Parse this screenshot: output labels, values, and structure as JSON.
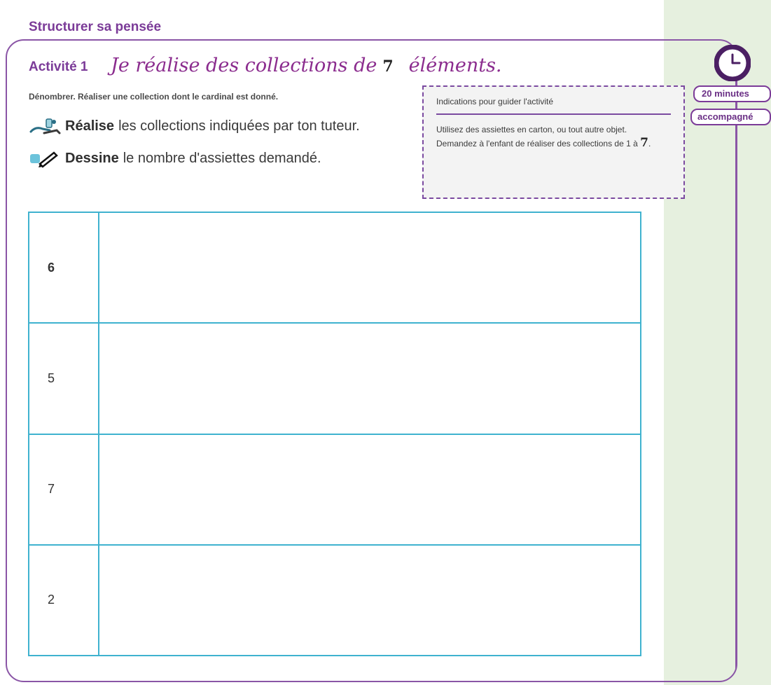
{
  "header": {
    "section_title": "Structurer sa pensée"
  },
  "activity": {
    "label": "Activité 1",
    "title_part1": "Je réalise des collections de",
    "title_number": "7",
    "title_part2": "éléments.",
    "objective": "Dénombrer. Réaliser une collection dont le cardinal est donné."
  },
  "time_badges": {
    "duration": "20 minutes",
    "mode": "accompagné"
  },
  "instructions": [
    {
      "icon": "hands-manipulation-icon",
      "verb": "Réalise",
      "text": "les collections indiquées par ton tuteur."
    },
    {
      "icon": "eraser-pencil-icon",
      "verb": "Dessine",
      "text": "le nombre d'assiettes demandé."
    }
  ],
  "guide_box": {
    "title": "Indications pour guider l'activité",
    "paragraph1": "Utilisez des assiettes en carton, ou tout autre objet.",
    "paragraph2": "Demandez à l'enfant de réaliser des collections de 1 à",
    "paragraph2_number": "7",
    "paragraph2_end": "."
  },
  "table": {
    "rows": [
      "6",
      "5",
      "7",
      "2"
    ]
  },
  "colors": {
    "accent_purple": "#7b3b98",
    "grid_cyan": "#3fb2cf",
    "side_band": "#e6f0df"
  }
}
